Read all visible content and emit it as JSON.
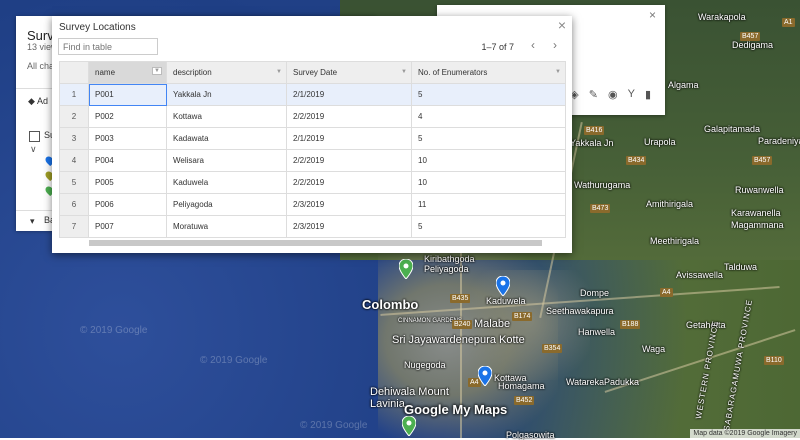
{
  "dialog": {
    "title": "Survey Locations",
    "search_placeholder": "Find in table",
    "pager": "1–7 of 7",
    "columns": [
      "name",
      "description",
      "Survey Date",
      "No. of Enumerators"
    ],
    "rows": [
      {
        "index": "1",
        "name": "P001",
        "description": "Yakkala Jn",
        "date": "2/1/2019",
        "enumerators": "5"
      },
      {
        "index": "2",
        "name": "P002",
        "description": "Kottawa",
        "date": "2/2/2019",
        "enumerators": "4"
      },
      {
        "index": "3",
        "name": "P003",
        "description": "Kadawata",
        "date": "2/1/2019",
        "enumerators": "5"
      },
      {
        "index": "4",
        "name": "P004",
        "description": "Welisara",
        "date": "2/2/2019",
        "enumerators": "10"
      },
      {
        "index": "5",
        "name": "P005",
        "description": "Kaduwela",
        "date": "2/2/2019",
        "enumerators": "10"
      },
      {
        "index": "6",
        "name": "P006",
        "description": "Peliyagoda",
        "date": "2/3/2019",
        "enumerators": "11"
      },
      {
        "index": "7",
        "name": "P007",
        "description": "Moratuwa",
        "date": "2/3/2019",
        "enumerators": "5"
      }
    ]
  },
  "legend": {
    "title": "Surve",
    "views": "13 view",
    "all_changes": "All cha",
    "add_layer": "Ad",
    "layer_name": "Su",
    "basemap": "Ba"
  },
  "map": {
    "places": {
      "colombo": "Colombo",
      "kotte": "Sri Jayawardenepura Kotte",
      "malabe": "Malabe",
      "nugegoda": "Nugegoda",
      "dehiwala": "Dehiwala Mount Lavinia",
      "kaduwela": "Kaduwela",
      "homagama": "Homagama",
      "seethawaka": "Seethawakapura",
      "hanwella": "Hanwella",
      "dompe": "Dompe",
      "kiribathgoda": "Kiribathgoda",
      "wathurugama": "Wathurugama",
      "amithirigala": "Amithirigala",
      "meethirigala": "Meethirigala",
      "avissawella": "Avissawella",
      "getahetta": "Getahetta",
      "ruwanwella": "Ruwanwella",
      "karawanella": "Karawanella",
      "magammana": "Magammana",
      "taldua": "Talduwa",
      "galapitamada": "Galapitamada",
      "paradeniya": "Paradeniya",
      "warakapola": "Warakapola",
      "dedigama": "Dedigama",
      "algama": "Algama",
      "urapola": "Urapola",
      "yakkala": "Yakkala Jn",
      "colombo_garden": "CINNAMON GARDENS",
      "kottawa": "Kottawa",
      "watareka": "Watareka",
      "padukka": "Padukka",
      "waga": "Waga",
      "peliyagoda": "Peliyagoda",
      "western": "WESTERN PROVINCE",
      "sabaragamuwa": "SABARAGAMUWA PROVINCE",
      "pelawatta": "Polgasowita",
      "kotte2": "Kotte"
    },
    "logo": "Google My Maps",
    "attribution": "Map data ©2019 Google Imagery",
    "watermark": "© 2019 Google"
  },
  "colors": {
    "pin_blue": "#1a73e8",
    "pin_green": "#4caf50",
    "pin_olive": "#9e9d24",
    "selection": "#e8effb",
    "accent": "#4285f4"
  }
}
